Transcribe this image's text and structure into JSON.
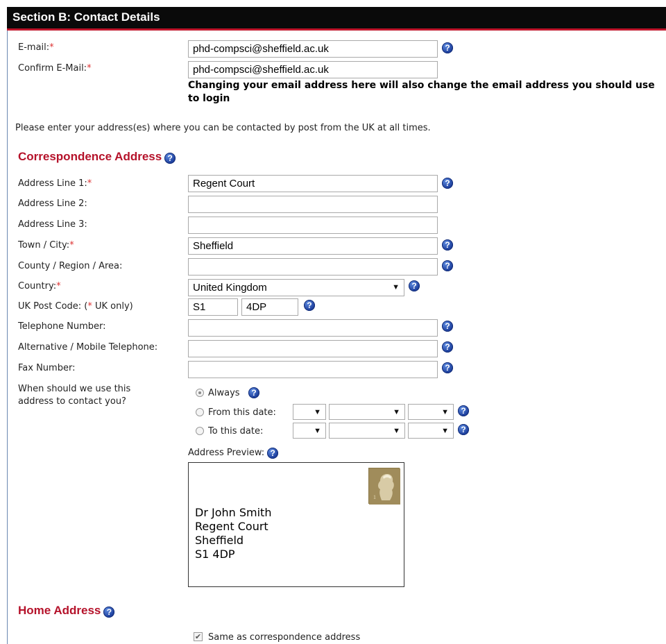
{
  "section": {
    "title": "Section B: Contact Details"
  },
  "email": {
    "label": "E-mail:",
    "required": "*",
    "value": "phd-compsci@sheffield.ac.uk",
    "confirm_label": "Confirm E-Mail:",
    "confirm_value": "phd-compsci@sheffield.ac.uk",
    "warning": "Changing your email address here will also change the email address you should use to login"
  },
  "address_info": "Please enter your address(es) where you can be contacted by post from the UK at all times.",
  "correspondence": {
    "heading": "Correspondence Address",
    "line1_label": "Address Line 1:",
    "line1_value": "Regent Court",
    "line2_label": "Address Line 2:",
    "line2_value": "",
    "line3_label": "Address Line 3:",
    "line3_value": "",
    "town_label": "Town / City:",
    "town_value": "Sheffield",
    "county_label": "County / Region / Area:",
    "county_value": "",
    "country_label": "Country:",
    "country_value": "United Kingdom",
    "postcode_label_prefix": "UK Post Code: (",
    "postcode_label_star": "*",
    "postcode_label_suffix": " UK only)",
    "postcode_part1": "S1",
    "postcode_part2": "4DP",
    "phone_label": "Telephone Number:",
    "phone_value": "",
    "mobile_label": "Alternative / Mobile Telephone:",
    "mobile_value": "",
    "fax_label": "Fax Number:",
    "fax_value": "",
    "when_label_line1": "When should we use this",
    "when_label_line2": "address to contact you?",
    "opt_always": "Always",
    "opt_from": "From this date:",
    "opt_to": "To this date:",
    "selected_option": "always",
    "preview_label": "Address Preview:",
    "preview_lines": [
      "Dr John Smith",
      "Regent Court",
      "Sheffield",
      "S1 4DP"
    ]
  },
  "home": {
    "heading": "Home Address",
    "same_label": "Same as correspondence address",
    "same_checked": true
  },
  "icons": {
    "help": "help-icon",
    "dropdown": "dropdown-arrow-icon",
    "stamp": "postage-stamp-icon"
  },
  "colors": {
    "header_bg": "#0a0a0a",
    "header_rule": "#c0152b",
    "subhead": "#b5122a",
    "required": "#dd3333",
    "help": "#1b3c9a"
  }
}
